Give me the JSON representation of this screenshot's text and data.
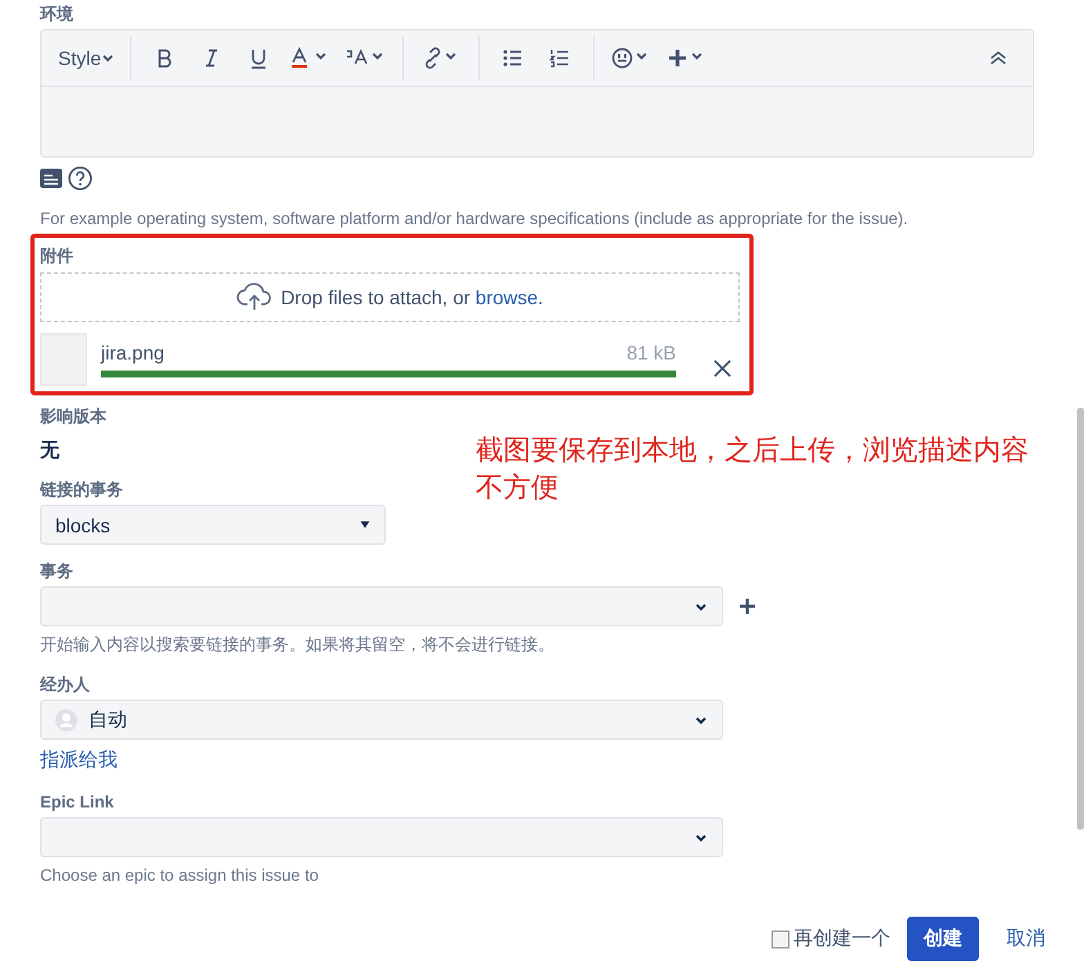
{
  "environment": {
    "label": "环境",
    "style_menu": "Style",
    "hint": "For example operating system, software platform and/or hardware specifications (include as appropriate for the issue)."
  },
  "attachment": {
    "label": "附件",
    "drop_text": "Drop files to attach, or ",
    "browse_link": "browse.",
    "file": {
      "name": "jira.png",
      "size": "81 kB",
      "level": 1.0
    }
  },
  "affects_version": {
    "label": "影响版本",
    "value": "无"
  },
  "linked_issues": {
    "label": "链接的事务",
    "value": "blocks"
  },
  "issue": {
    "label": "事务",
    "hint": "开始输入内容以搜索要链接的事务。如果将其留空，将不会进行链接。"
  },
  "assignee": {
    "label": "经办人",
    "value": "自动",
    "assign_to_me": "指派给我"
  },
  "epic_link": {
    "label": "Epic Link",
    "hint": "Choose an epic to assign this issue to"
  },
  "annotation": "截图要保存到本地，之后上传，浏览描述内容不方便",
  "footer": {
    "create_another": {
      "label": "再创建一个",
      "checked": false
    },
    "create": "创建",
    "cancel": "取消"
  }
}
